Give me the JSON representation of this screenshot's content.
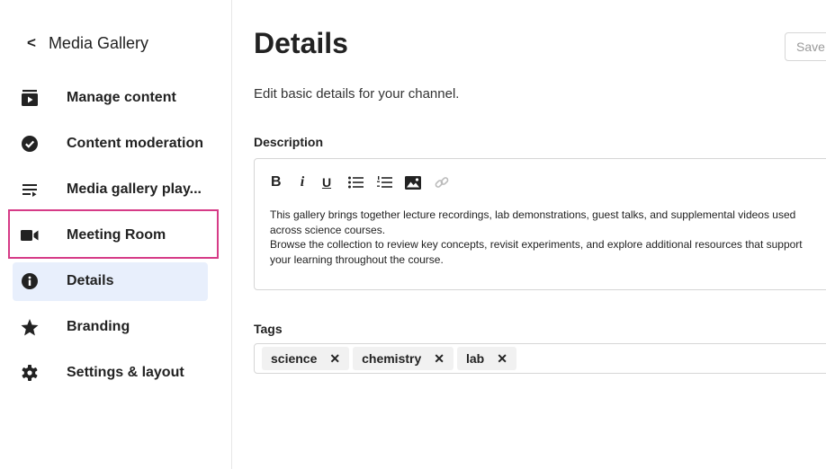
{
  "sidebar": {
    "back_label": "Media Gallery",
    "items": [
      {
        "label": "Manage content",
        "icon": "play-box-icon"
      },
      {
        "label": "Content moderation",
        "icon": "check-circle-icon"
      },
      {
        "label": "Media gallery play...",
        "icon": "playlist-icon"
      },
      {
        "label": "Meeting Room",
        "icon": "video-camera-icon"
      },
      {
        "label": "Details",
        "icon": "info-icon"
      },
      {
        "label": "Branding",
        "icon": "star-icon"
      },
      {
        "label": "Settings & layout",
        "icon": "gear-icon"
      }
    ],
    "active_item": "Details",
    "highlighted_item": "Meeting Room"
  },
  "main": {
    "title": "Details",
    "save_label": "Save",
    "subtitle": "Edit basic details for your channel.",
    "description": {
      "label": "Description",
      "toolbar": {
        "bold": "B",
        "italic": "i",
        "underline": "U"
      },
      "paragraphs": [
        "This gallery brings together lecture recordings, lab demonstrations, guest talks, and supplemental videos used across science courses.",
        "Browse the collection to review key concepts, revisit experiments, and explore additional resources that support your learning throughout the course."
      ]
    },
    "tags": {
      "label": "Tags",
      "items": [
        "science",
        "chemistry",
        "lab"
      ],
      "remove_symbol": "✕"
    }
  },
  "colors": {
    "active_bg": "#e8effc",
    "highlight_border": "#d63b87",
    "text": "#222222"
  }
}
